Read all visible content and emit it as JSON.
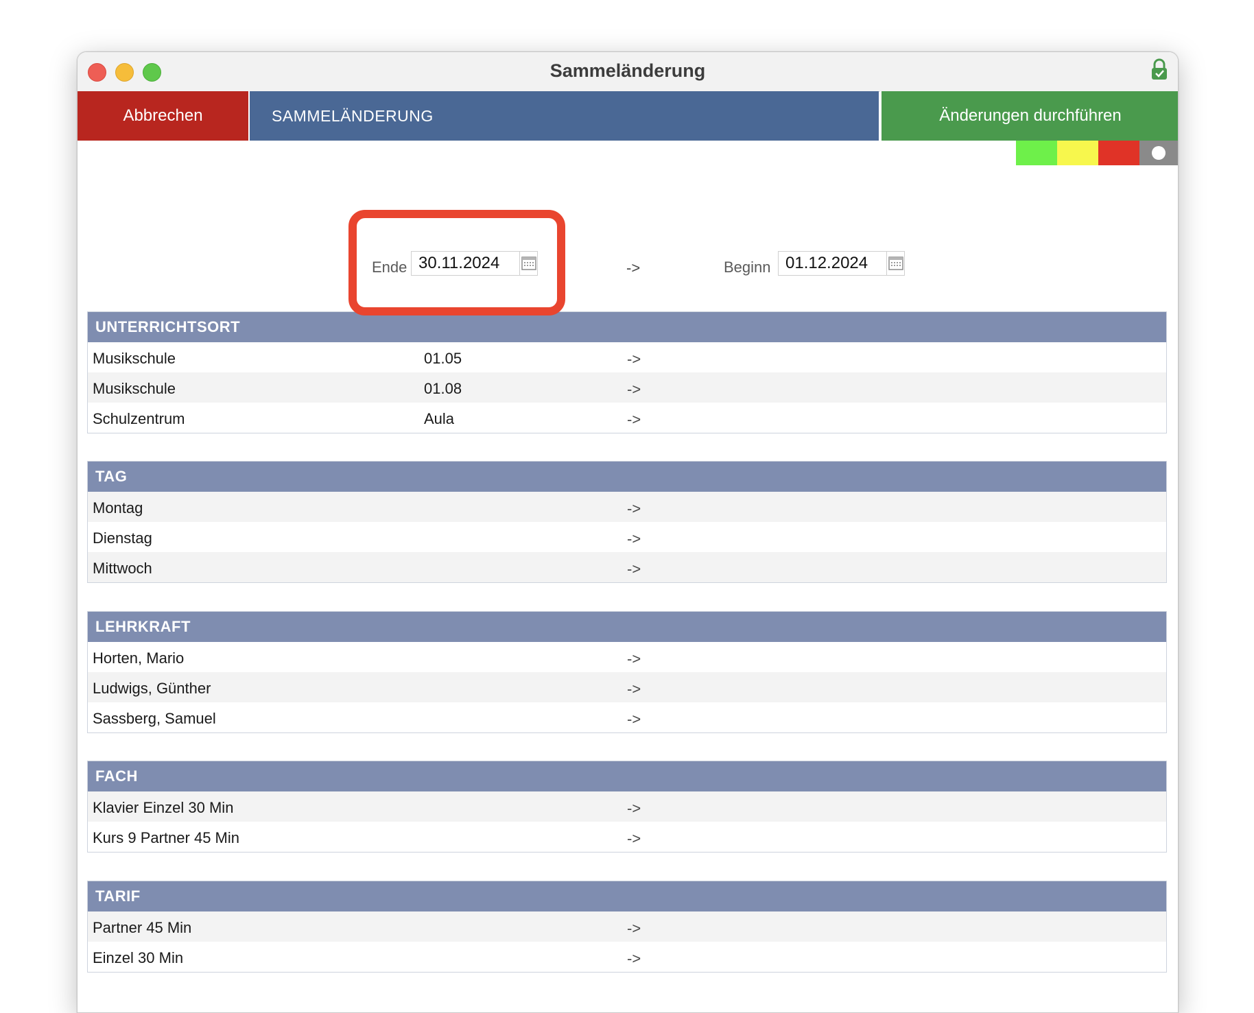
{
  "window": {
    "title": "Sammeländerung"
  },
  "toolbar": {
    "cancel_label": "Abbrechen",
    "title": "SAMMELÄNDERUNG",
    "apply_label": "Änderungen durchführen"
  },
  "swatches": {
    "colors": [
      "#6ef04a",
      "#f7f74d",
      "#e03327",
      "#8a8a8a"
    ]
  },
  "dates": {
    "end_label": "Ende",
    "end_value": "30.11.2024",
    "arrow": "->",
    "begin_label": "Beginn",
    "begin_value": "01.12.2024"
  },
  "highlight_color": "#e9452f",
  "sections": {
    "unterrichtsort": {
      "title": "UNTERRICHTSORT",
      "rows": [
        {
          "name": "Musikschule",
          "room": "01.05",
          "arrow": "->"
        },
        {
          "name": "Musikschule",
          "room": "01.08",
          "arrow": "->"
        },
        {
          "name": "Schulzentrum",
          "room": "Aula",
          "arrow": "->"
        }
      ]
    },
    "tag": {
      "title": "TAG",
      "rows": [
        {
          "name": "Montag",
          "arrow": "->"
        },
        {
          "name": "Dienstag",
          "arrow": "->"
        },
        {
          "name": "Mittwoch",
          "arrow": "->"
        }
      ]
    },
    "lehrkraft": {
      "title": "LEHRKRAFT",
      "rows": [
        {
          "name": "Horten, Mario",
          "arrow": "->"
        },
        {
          "name": "Ludwigs, Günther",
          "arrow": "->"
        },
        {
          "name": "Sassberg, Samuel",
          "arrow": "->"
        }
      ]
    },
    "fach": {
      "title": "FACH",
      "rows": [
        {
          "name": "Klavier Einzel 30 Min",
          "arrow": "->"
        },
        {
          "name": "Kurs 9 Partner 45 Min",
          "arrow": "->"
        }
      ]
    },
    "tarif": {
      "title": "TARIF",
      "rows": [
        {
          "name": "Partner 45 Min",
          "arrow": "->"
        },
        {
          "name": "Einzel 30 Min",
          "arrow": "->"
        }
      ]
    }
  }
}
